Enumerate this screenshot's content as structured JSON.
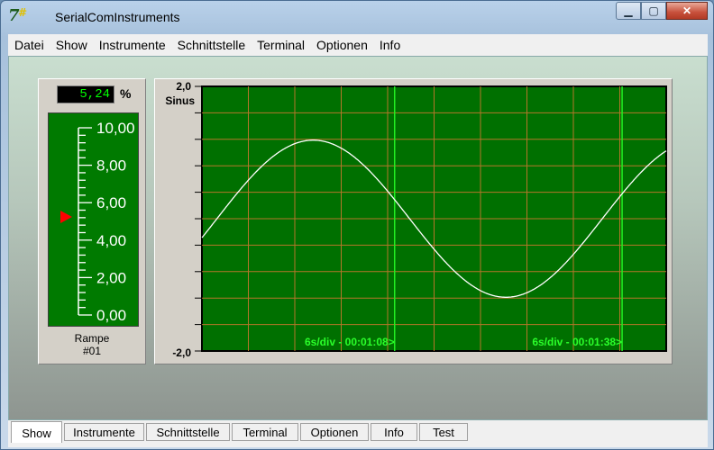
{
  "window": {
    "title": "SerialComInstruments",
    "icon": "app-7-icon",
    "controls": [
      "minimize-icon",
      "maximize-icon",
      "close-icon"
    ]
  },
  "menu": [
    "Datei",
    "Show",
    "Instrumente",
    "Schnittstelle",
    "Terminal",
    "Optionen",
    "Info"
  ],
  "instrument": {
    "value": "5,24",
    "unit": "%",
    "scale": [
      "10,00",
      "8,00",
      "6,00",
      "4,00",
      "2,00",
      "0,00"
    ],
    "pointer_value": 5.24,
    "name": "Rampe",
    "number": "#01"
  },
  "chart": {
    "ymax_label": "2,0",
    "ymin_label": "-2,0",
    "series_label": "Sinus",
    "marker1": "6s/div - 00:01:08>",
    "marker2": "6s/div - 00:01:38>"
  },
  "chart_data": {
    "type": "line",
    "ylim": [
      -2.0,
      2.0
    ],
    "series": [
      {
        "name": "Sinus",
        "amplitude": 1.25,
        "period_divisions": 8.3,
        "start_phase_deg": -14
      }
    ]
  },
  "tabs": [
    "Show",
    "Instrumente",
    "Schnittstelle",
    "Terminal",
    "Optionen",
    "Info",
    "Test"
  ],
  "active_tab": "Show",
  "colors": {
    "plot_bg": "#007000",
    "grid": "#b5762a",
    "trace": "#ffffff",
    "marker_text": "#2aff2a",
    "readout": "#00ff00",
    "pointer": "#ff0000"
  }
}
